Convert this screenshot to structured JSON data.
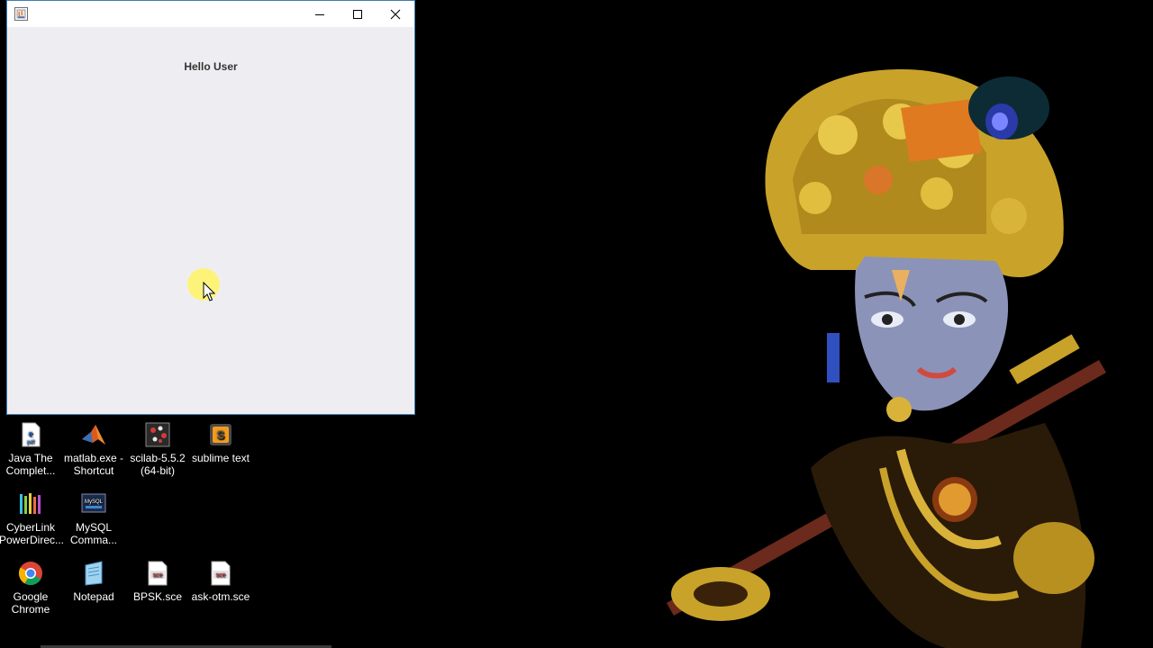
{
  "window": {
    "title": "",
    "message": "Hello User",
    "controls": [
      "minimize-icon",
      "maximize-icon",
      "close-icon"
    ]
  },
  "desktop": {
    "icons": [
      {
        "label": "Java The\nComplet...",
        "icon": "pdf-document-icon"
      },
      {
        "label": "matlab.exe -\nShortcut",
        "icon": "matlab-icon"
      },
      {
        "label": "scilab-5.5.2\n(64-bit)",
        "icon": "scilab-icon"
      },
      {
        "label": "sublime text",
        "icon": "sublime-text-icon"
      },
      {
        "label": "CyberLink\nPowerDirec...",
        "icon": "cyberlink-icon"
      },
      {
        "label": "MySQL\nComma...",
        "icon": "mysql-icon"
      },
      {
        "label": "Google\nChrome",
        "icon": "chrome-icon"
      },
      {
        "label": "Notepad",
        "icon": "notepad-icon"
      },
      {
        "label": "BPSK.sce",
        "icon": "sce-file-icon"
      },
      {
        "label": "ask-otm.sce",
        "icon": "sce-file-icon"
      }
    ]
  },
  "colors": {
    "desktop_background": "#000000",
    "window_border": "#3c7fb1",
    "window_client": "#eeeef2",
    "cursor_highlight": "#fff36b"
  }
}
